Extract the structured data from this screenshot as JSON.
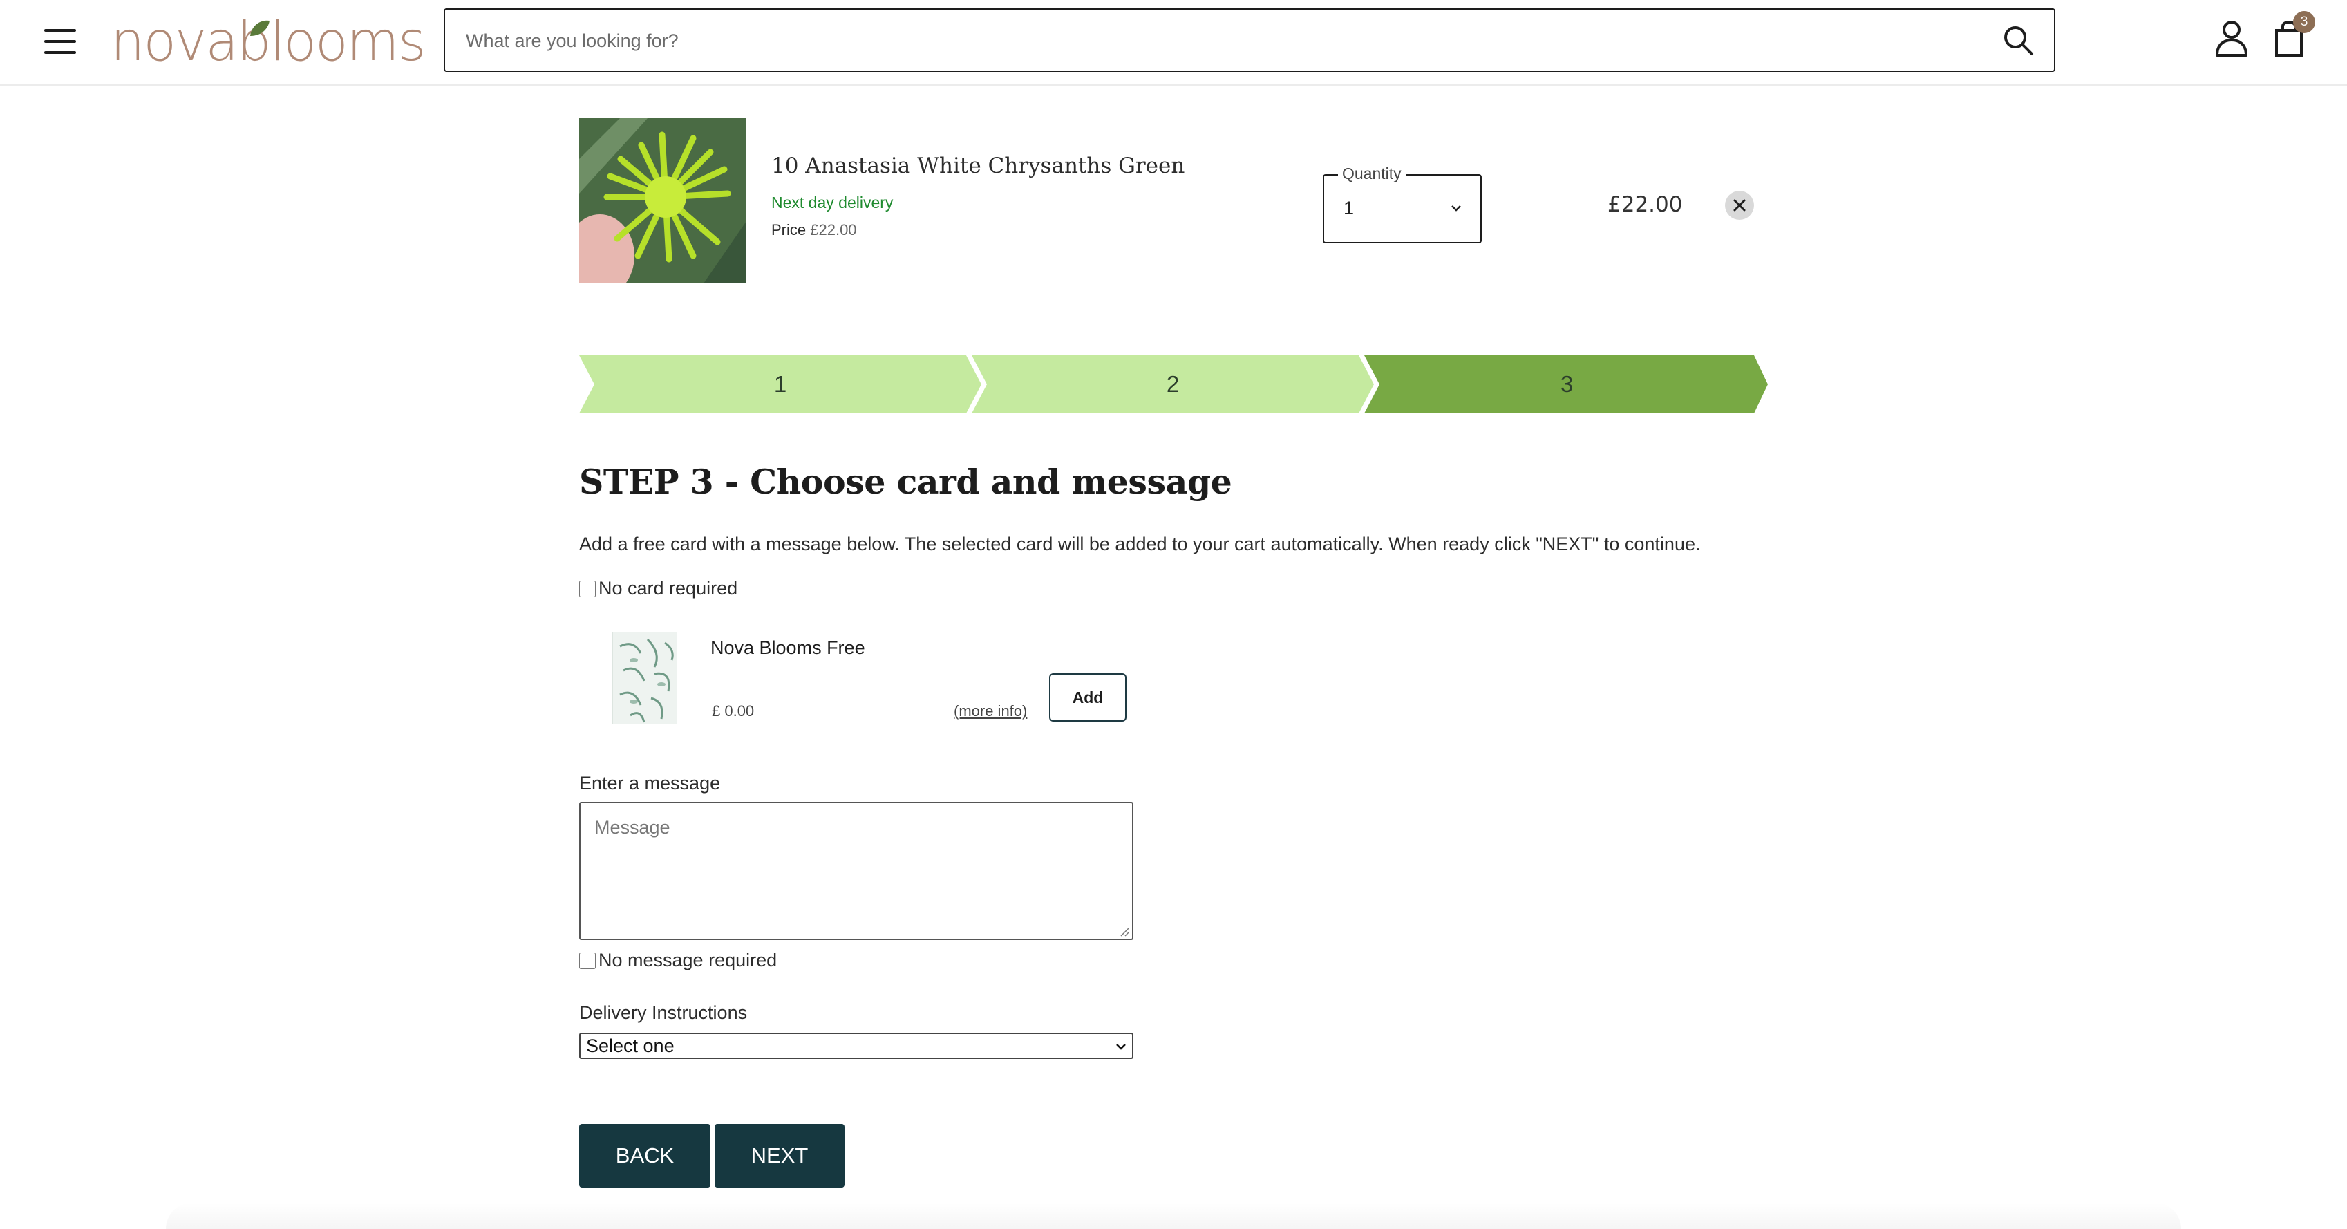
{
  "header": {
    "logo_text": "novablooms",
    "search_placeholder": "What are you looking for?",
    "cart_count": "3"
  },
  "product": {
    "title": "10 Anastasia White Chrysanths Green",
    "delivery": "Next day delivery",
    "price_label": "Price",
    "price_value": "£22.00",
    "quantity_label": "Quantity",
    "quantity_value": "1",
    "line_total": "£22.00"
  },
  "stepper": {
    "steps": [
      "1",
      "2",
      "3"
    ],
    "active_step": 3,
    "colors": {
      "inactive": "#c5ea9f",
      "active": "#78a944"
    }
  },
  "step3": {
    "title": "STEP 3 - Choose card and message",
    "description": "Add a free card with a message below. The selected card will be added to your cart automatically. When ready click \"NEXT\" to continue.",
    "no_card_label": "No card required",
    "card": {
      "name": "Nova Blooms Free",
      "price": "£ 0.00",
      "more_info": "(more info)",
      "add_label": "Add"
    },
    "message_label": "Enter a message",
    "message_placeholder": "Message",
    "no_message_label": "No message required",
    "delivery_label": "Delivery Instructions",
    "delivery_selected": "Select one"
  },
  "buttons": {
    "back": "BACK",
    "next": "NEXT"
  },
  "colors": {
    "brand": "#b08a76",
    "primary_button": "#163840",
    "delivery_green": "#1e8a2e"
  }
}
